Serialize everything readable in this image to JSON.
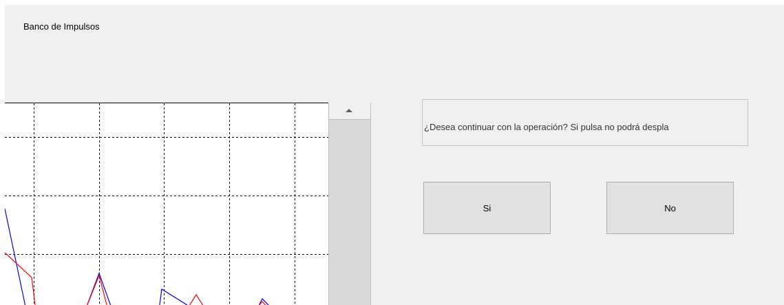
{
  "panel": {
    "title": "Banco de Impulsos"
  },
  "dialog": {
    "message": "¿Desea continuar con la operación? Si pulsa no podrá despla",
    "yes_label": "Si",
    "no_label": "No"
  },
  "plot": {
    "grid": "dashed",
    "grid_color": "#000000",
    "series": [
      {
        "color": "#0000ff"
      },
      {
        "color": "#ff0000"
      }
    ]
  },
  "colors": {
    "background": "#f0f0f0",
    "button_bg": "#e1e1e1",
    "button_border": "#adadad"
  }
}
